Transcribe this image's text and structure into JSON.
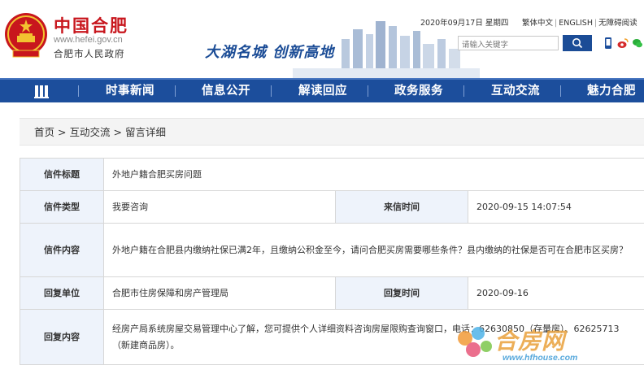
{
  "header": {
    "site_name": "中国合肥",
    "site_url": "www.hefei.gov.cn",
    "site_subtitle": "合肥市人民政府",
    "slogan": "大湖名城  创新高地",
    "date_text": "2020年09月17日 星期四",
    "lang_links": [
      "繁体中文",
      "ENGLISH",
      "无障碍阅读"
    ],
    "search": {
      "placeholder": "请输入关键字",
      "button_label": ""
    },
    "social_icons": [
      "mobile-icon",
      "weibo-icon",
      "wechat-icon"
    ],
    "brand_color": "#c8161d"
  },
  "nav": {
    "items": [
      "时事新闻",
      "信息公开",
      "解读回应",
      "政务服务",
      "互动交流",
      "魅力合肥"
    ],
    "bg_color": "#1c4e9c"
  },
  "breadcrumb": {
    "items": [
      "首页",
      "互动交流",
      "留言详细"
    ],
    "separator": ">"
  },
  "detail": {
    "title_label": "信件标题",
    "title_value": "外地户籍合肥买房问题",
    "type_label": "信件类型",
    "type_value": "我要咨询",
    "time_label": "来信时间",
    "time_value": "2020-09-15 14:07:54",
    "content_label": "信件内容",
    "content_value": "外地户籍在合肥县内缴纳社保已满2年，且缴纳公积金至今，请问合肥买房需要哪些条件？县内缴纳的社保是否可在合肥市区买房？",
    "reply_unit_label": "回复单位",
    "reply_unit_value": "合肥市住房保障和房产管理局",
    "reply_time_label": "回复时间",
    "reply_time_value": "2020-09-16",
    "reply_content_label": "回复内容",
    "reply_content_value": "经房产局系统房屋交易管理中心了解，您可提供个人详细资料咨询房屋限购查询窗口，电话：62630850（存量房）、62625713（新建商品房）。"
  },
  "watermark": {
    "logo_text": "合房网",
    "logo_url": "www.hfhouse.com"
  }
}
